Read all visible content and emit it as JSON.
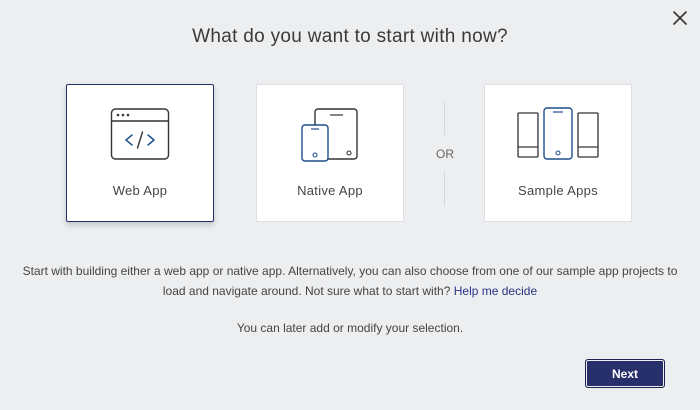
{
  "dialog": {
    "title": "What do you want to start with now?",
    "close_icon": "close-icon"
  },
  "options": [
    {
      "label": "Web App",
      "icon": "web-app-icon",
      "selected": true
    },
    {
      "label": "Native App",
      "icon": "native-app-icon",
      "selected": false
    },
    {
      "label": "Sample Apps",
      "icon": "sample-apps-icon",
      "selected": false
    }
  ],
  "separator": {
    "text": "OR"
  },
  "description": {
    "text": "Start with building either a web app or native app. Alternatively, you can also choose from one of our sample app projects to load and navigate around. Not sure what to start with?",
    "link": "Help me decide"
  },
  "note": "You can later add or modify your selection.",
  "footer": {
    "next_label": "Next"
  },
  "colors": {
    "accent": "#27306b",
    "icon_accent": "#1f4f8c",
    "background": "#eceef0",
    "card": "#ffffff"
  }
}
